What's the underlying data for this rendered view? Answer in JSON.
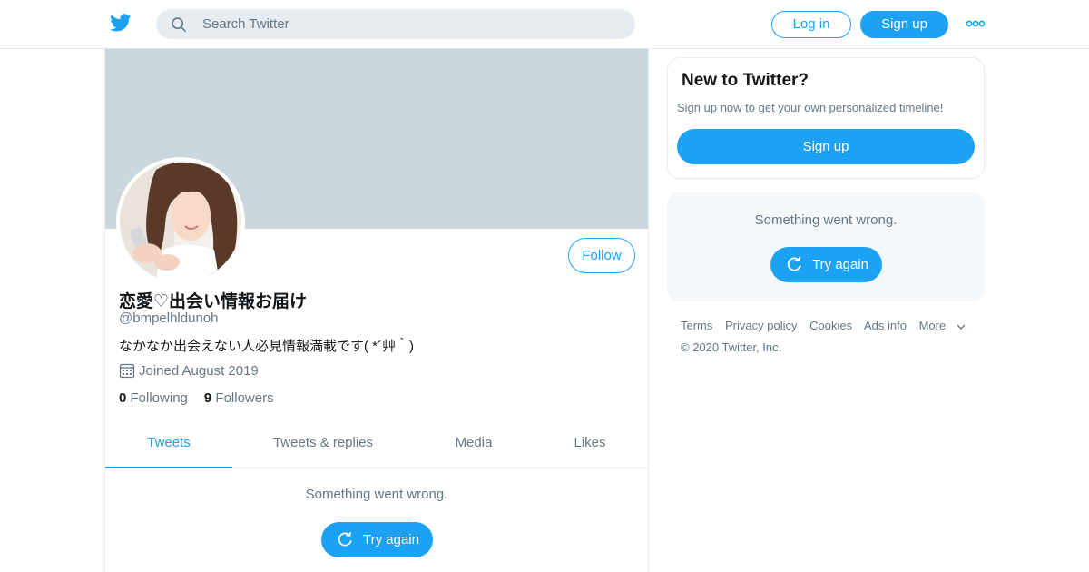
{
  "colors": {
    "accent": "#1da1f2",
    "banner": "#ccd6dd",
    "muted_text": "#657786",
    "panel_bg": "#f5f8fa"
  },
  "header": {
    "logo_icon": "twitter-bird-icon",
    "search_placeholder": "Search Twitter",
    "login_label": "Log in",
    "signup_label": "Sign up",
    "more_icon": "more-dots-icon"
  },
  "profile": {
    "follow_label": "Follow",
    "display_name": "恋愛♡出会い情報お届け",
    "handle": "@bmpelhldunoh",
    "bio": "なかなか出会えない人必見情報満載です( *´艸｀)",
    "joined": "Joined August 2019",
    "following_count": "0",
    "following_label": "Following",
    "followers_count": "9",
    "followers_label": "Followers"
  },
  "tabs": [
    {
      "label": "Tweets",
      "active": true
    },
    {
      "label": "Tweets & replies",
      "active": false
    },
    {
      "label": "Media",
      "active": false
    },
    {
      "label": "Likes",
      "active": false
    }
  ],
  "timeline": {
    "error_message": "Something went wrong.",
    "retry_label": "Try again"
  },
  "sidebar": {
    "new_title": "New to Twitter?",
    "new_subtitle": "Sign up now to get your own personalized timeline!",
    "signup_label": "Sign up",
    "error_message": "Something went wrong.",
    "retry_label": "Try again"
  },
  "footer": {
    "links": [
      "Terms",
      "Privacy policy",
      "Cookies",
      "Ads info",
      "More"
    ],
    "copyright": "© 2020 Twitter, Inc."
  }
}
